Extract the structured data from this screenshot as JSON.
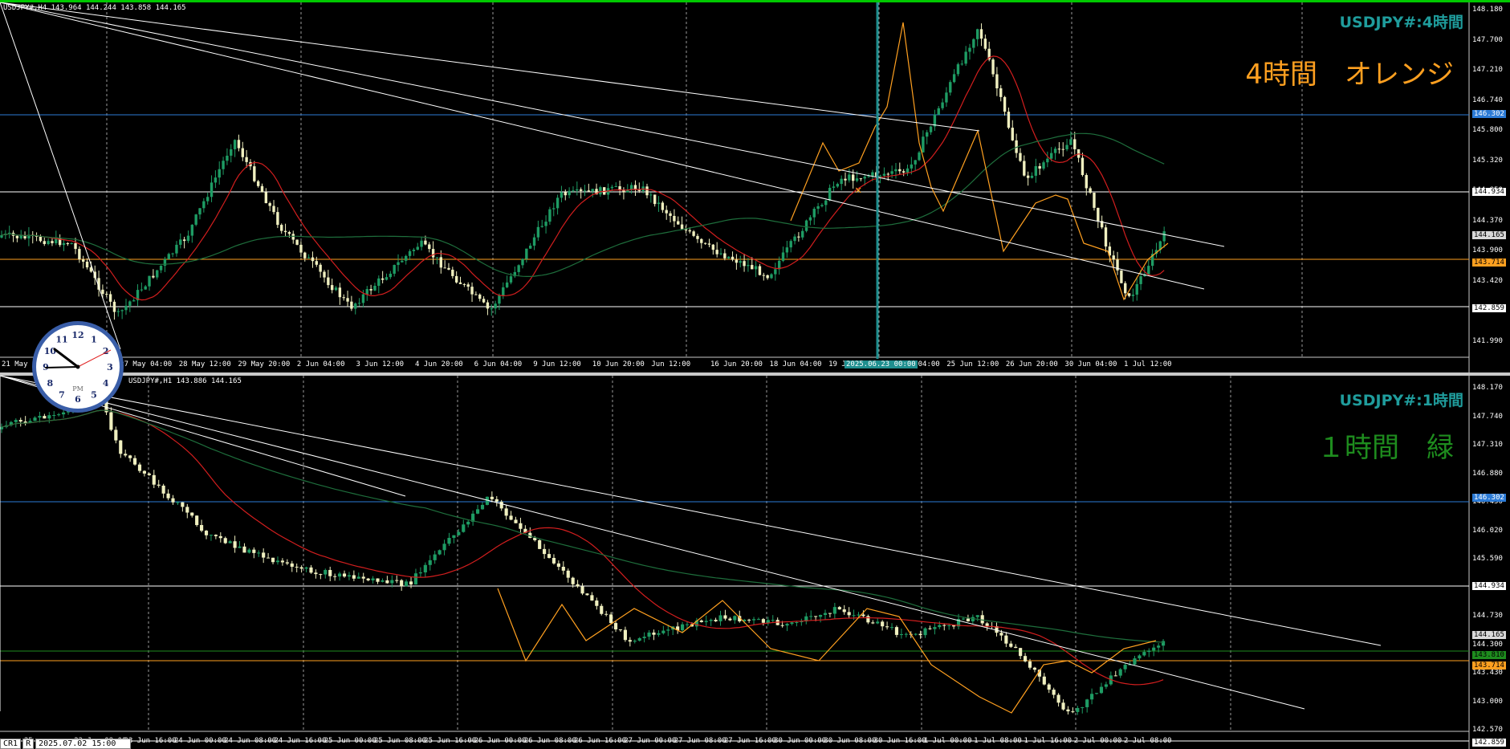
{
  "top_chart": {
    "info": "USDJPY#,H4  143.964 144.244 143.858 144.165",
    "title": "USDJPY#:4時間",
    "label": "4時間　オレンジ",
    "label_color": "#ffa020",
    "price_labels": [
      "148.180",
      "147.700",
      "147.210",
      "146.740",
      "145.800",
      "145.320",
      "144.850",
      "144.370",
      "143.900",
      "143.420",
      "142.470",
      "141.990"
    ],
    "price_tags": [
      {
        "text": "146.302",
        "bg": "#2c7bd6",
        "fg": "#ffffff"
      },
      {
        "text": "144.934",
        "bg": "#ffffff",
        "fg": "#000000"
      },
      {
        "text": "144.165",
        "bg": "#d8d8d8",
        "fg": "#000000"
      },
      {
        "text": "143.714",
        "bg": "#ffa020",
        "fg": "#000000"
      },
      {
        "text": "142.859",
        "bg": "#ffffff",
        "fg": "#000000"
      }
    ],
    "time_labels": [
      "21 May 2",
      "20:00",
      "27 May 04:00",
      "28 May 12:00",
      "29 May 20:00",
      "2 Jun 04:00",
      "3 Jun 12:00",
      "4 Jun 20:00",
      "6 Jun 04:00",
      "9 Jun 12:00",
      "10 Jun 20:00",
      "Jun 12:00",
      "16 Jun 20:00",
      "18 Jun 04:00",
      "19 Jun",
      "24 Jun 04:00",
      "25 Jun 12:00",
      "26 Jun 20:00",
      "30 Jun 04:00",
      "1 Jul 12:00"
    ],
    "crosshair_time": "2025.06.23 00:00"
  },
  "bottom_chart": {
    "info": "USDJPY#,H1  143.886 144.165",
    "title": "USDJPY#:1時間",
    "label": "１時間　緑",
    "label_color": "#1e8c1e",
    "price_labels": [
      "148.170",
      "147.740",
      "147.310",
      "146.880",
      "146.450",
      "146.020",
      "145.590",
      "145.160",
      "144.730",
      "144.300",
      "143.430",
      "143.000",
      "142.570"
    ],
    "price_tags": [
      {
        "text": "146.302",
        "bg": "#2c7bd6",
        "fg": "#ffffff"
      },
      {
        "text": "144.934",
        "bg": "#ffffff",
        "fg": "#000000"
      },
      {
        "text": "144.165",
        "bg": "#d8d8d8",
        "fg": "#000000"
      },
      {
        "text": "143.810",
        "bg": "#1e8c1e",
        "fg": "#000000"
      },
      {
        "text": "143.714",
        "bg": "#ffa020",
        "fg": "#000000"
      },
      {
        "text": "142.859",
        "bg": "#ffffff",
        "fg": "#000000"
      }
    ],
    "time_labels": [
      "25",
      "23 Jun 08:00",
      "23 Jun 16:00",
      "24 Jun 00:00",
      "24 Jun 08:00",
      "24 Jun 16:00",
      "25 Jun 00:00",
      "25 Jun 08:00",
      "25 Jun 16:00",
      "26 Jun 00:00",
      "26 Jun 08:00",
      "26 Jun 16:00",
      "27 Jun 00:00",
      "27 Jun 08:00",
      "27 Jun 16:00",
      "30 Jun 00:00",
      "30 Jun 08:00",
      "30 Jun 16:00",
      "1 Jul 00:00",
      "1 Jul 08:00",
      "1 Jul 16:00",
      "2 Jul 00:00",
      "2 Jul 08:00"
    ]
  },
  "clock": {
    "pm_label": "PM",
    "numerals": [
      "12",
      "1",
      "2",
      "3",
      "4",
      "5",
      "6",
      "7",
      "8",
      "9",
      "10",
      "11"
    ]
  },
  "status_bar": {
    "tab1": "CR1",
    "tab2": "R",
    "datetime": "2025.07.02 15:00"
  },
  "colors": {
    "up": "#1e9c64",
    "down": "#f0f0c0",
    "ma_red": "#d21e1e",
    "ma_green": "#1e6e3c",
    "zigzag": "#ffa020",
    "trend": "#ffffff"
  }
}
